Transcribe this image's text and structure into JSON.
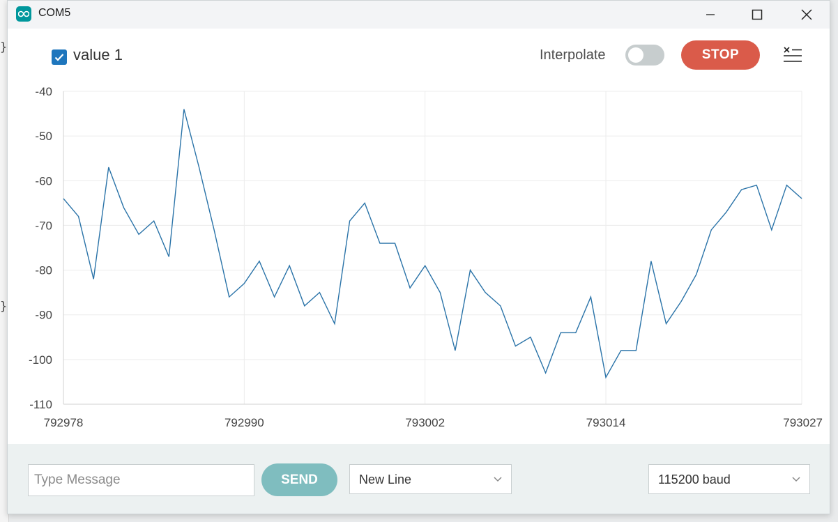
{
  "window": {
    "title": "COM5"
  },
  "toolbar": {
    "series_label": "value 1",
    "series_checked": true,
    "interpolate_label": "Interpolate",
    "interpolate_on": false,
    "stop_label": "STOP"
  },
  "colors": {
    "accent": "#00979c",
    "line": "#2a73a8",
    "stop": "#da5b4a",
    "send": "#7fbdbf",
    "checkbox": "#1e76bd"
  },
  "chart_data": {
    "type": "line",
    "title": "",
    "xlabel": "",
    "ylabel": "",
    "xlim": [
      792978,
      793027
    ],
    "ylim": [
      -110,
      -40
    ],
    "x_ticks": [
      "792978",
      "792990",
      "793002",
      "793014",
      "793027"
    ],
    "y_ticks": [
      "-40",
      "-50",
      "-60",
      "-70",
      "-80",
      "-90",
      "-100",
      "-110"
    ],
    "grid": true,
    "series": [
      {
        "name": "value 1",
        "x": [
          792978,
          792979,
          792980,
          792981,
          792982,
          792983,
          792984,
          792985,
          792986,
          792987,
          792988,
          792989,
          792990,
          792991,
          792992,
          792993,
          792994,
          792995,
          792996,
          792997,
          792998,
          792999,
          793000,
          793001,
          793002,
          793003,
          793004,
          793005,
          793006,
          793007,
          793008,
          793009,
          793010,
          793011,
          793012,
          793013,
          793014,
          793015,
          793016,
          793017,
          793018,
          793019,
          793020,
          793021,
          793022,
          793023,
          793024,
          793025,
          793026,
          793027
        ],
        "values": [
          -64,
          -68,
          -82,
          -57,
          -66,
          -72,
          -69,
          -77,
          -44,
          -57,
          -71,
          -86,
          -83,
          -78,
          -86,
          -79,
          -88,
          -85,
          -92,
          -69,
          -65,
          -74,
          -74,
          -84,
          -79,
          -85,
          -98,
          -80,
          -85,
          -88,
          -97,
          -95,
          -103,
          -94,
          -94,
          -86,
          -104,
          -98,
          -98,
          -78,
          -92,
          -87,
          -81,
          -71,
          -67,
          -62,
          -61,
          -71,
          -61,
          -64
        ]
      }
    ]
  },
  "bottom": {
    "message_placeholder": "Type Message",
    "message_value": "",
    "send_label": "SEND",
    "line_ending": "New Line",
    "baud_rate": "115200 baud"
  }
}
